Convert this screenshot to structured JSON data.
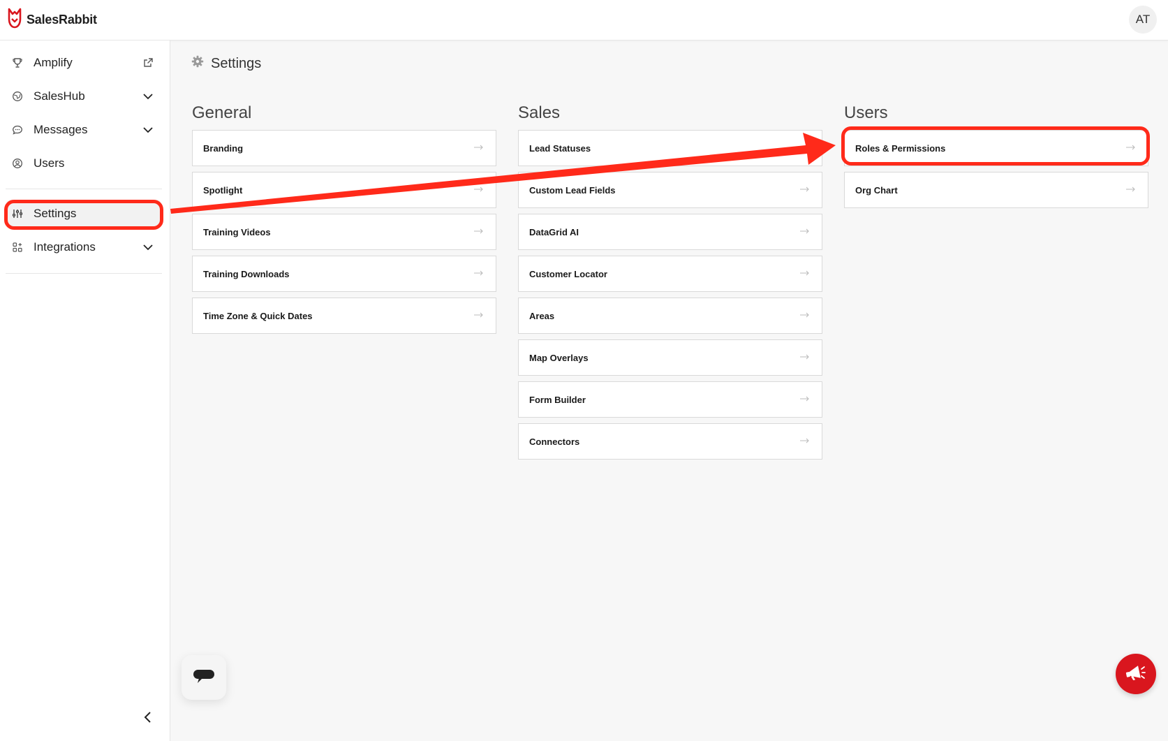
{
  "app": {
    "brand": "SalesRabbit",
    "user_initials": "AT"
  },
  "colors": {
    "accent": "#d9161e",
    "annotation": "#ff2a1a"
  },
  "sidebar": {
    "items": [
      {
        "label": "Amplify",
        "icon": "trophy-icon",
        "trail": "external-link-icon"
      },
      {
        "label": "SalesHub",
        "icon": "globe-icon",
        "trail": "chevron-down-icon"
      },
      {
        "label": "Messages",
        "icon": "chat-bubble-icon",
        "trail": "chevron-down-icon"
      },
      {
        "label": "Users",
        "icon": "user-circle-icon",
        "trail": ""
      },
      {
        "label": "Settings",
        "icon": "sliders-icon",
        "trail": "",
        "active": true
      },
      {
        "label": "Integrations",
        "icon": "grid-icon",
        "trail": "chevron-down-icon"
      }
    ],
    "collapse_icon": "chevron-left-icon"
  },
  "main": {
    "page_title": "Settings",
    "sections": [
      {
        "title": "General",
        "items": [
          "Branding",
          "Spotlight",
          "Training Videos",
          "Training Downloads",
          "Time Zone & Quick Dates"
        ]
      },
      {
        "title": "Sales",
        "items": [
          "Lead Statuses",
          "Custom Lead Fields",
          "DataGrid AI",
          "Customer Locator",
          "Areas",
          "Map Overlays",
          "Form Builder",
          "Connectors"
        ]
      },
      {
        "title": "Users",
        "items": [
          "Roles & Permissions",
          "Org Chart"
        ]
      }
    ]
  }
}
